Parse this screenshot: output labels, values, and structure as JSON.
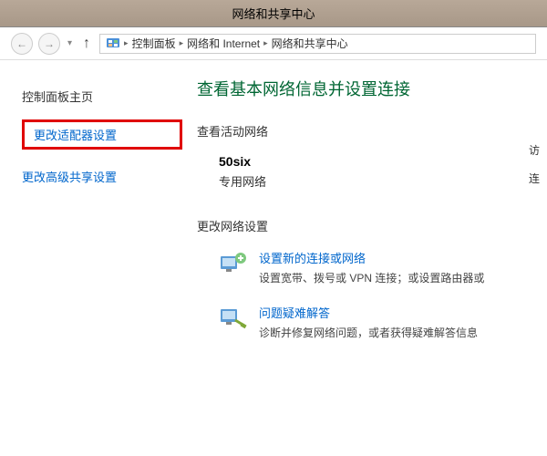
{
  "window": {
    "title": "网络和共享中心"
  },
  "breadcrumb": {
    "items": [
      "控制面板",
      "网络和 Internet",
      "网络和共享中心"
    ]
  },
  "sidebar": {
    "home": "控制面板主页",
    "adapter": "更改适配器设置",
    "sharing": "更改高级共享设置"
  },
  "main": {
    "title": "查看基本网络信息并设置连接",
    "active_section": "查看活动网络",
    "active_network": {
      "name": "50six",
      "type": "专用网络"
    },
    "change_section": "更改网络设置",
    "new_connection": {
      "link": "设置新的连接或网络",
      "desc": "设置宽带、拨号或 VPN 连接；或设置路由器或"
    },
    "troubleshoot": {
      "link": "问题疑难解答",
      "desc": "诊断并修复网络问题，或者获得疑难解答信息"
    }
  },
  "right": {
    "r1": "访",
    "r2": "连"
  }
}
